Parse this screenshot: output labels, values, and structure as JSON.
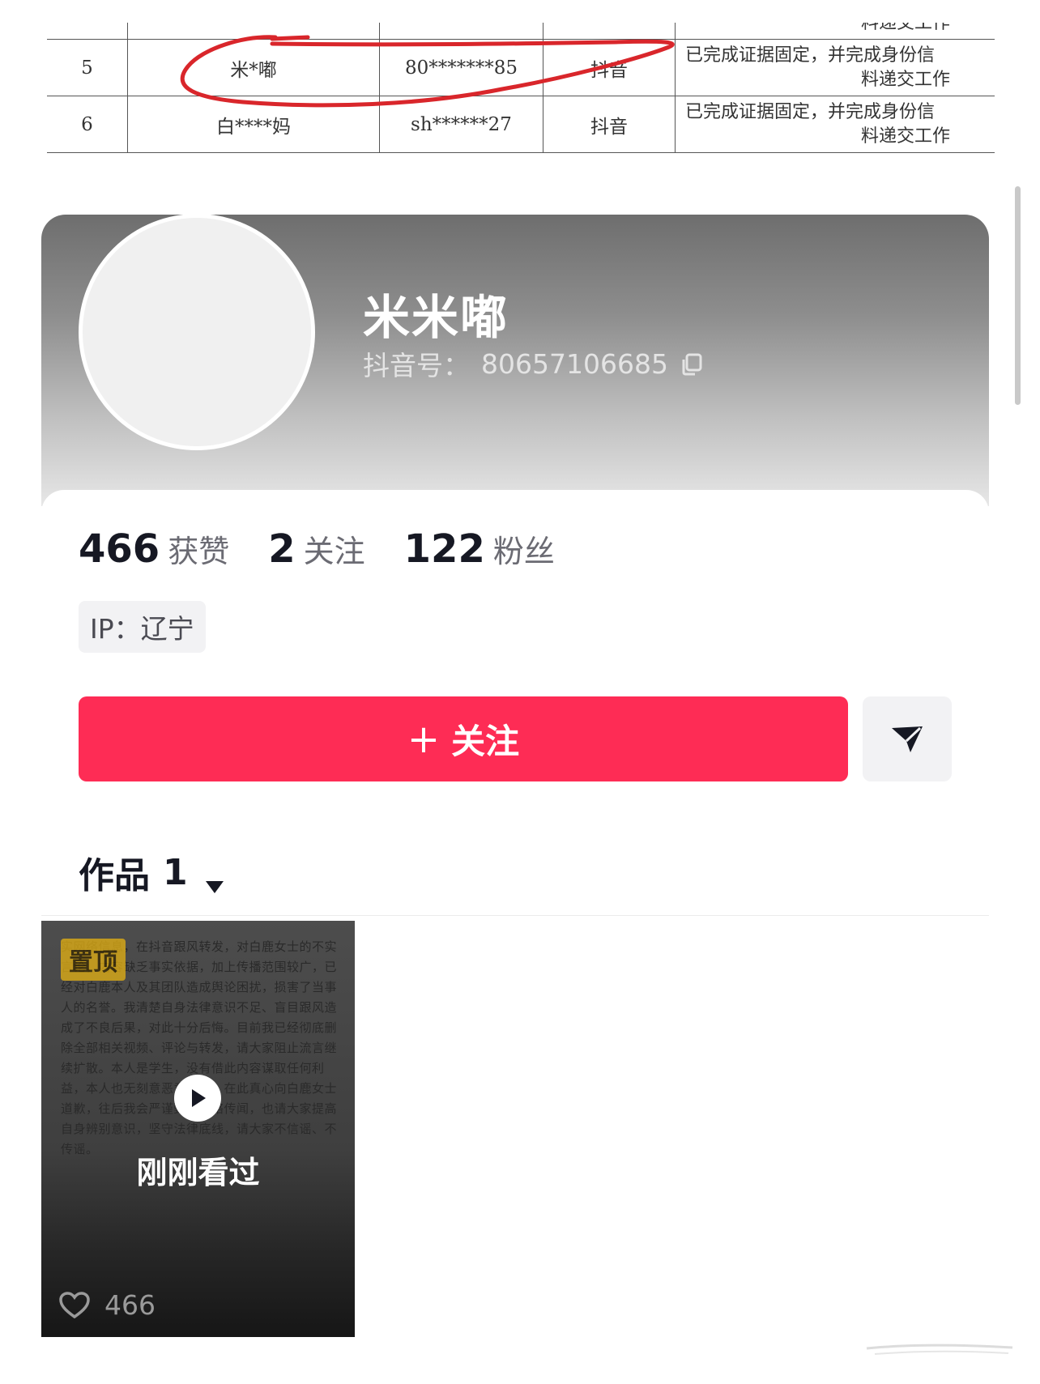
{
  "doc_table": {
    "top_row_fragment": "料递交工作",
    "rows": [
      {
        "no": "5",
        "name": "米*嘟",
        "account": "80*******85",
        "platform": "抖音",
        "status_line1": "已完成证据固定，并完成身份信",
        "status_line2": "料递交工作"
      },
      {
        "no": "6",
        "name": "白****妈",
        "account": "sh******27",
        "platform": "抖音",
        "status_line1": "已完成证据固定，并完成身份信",
        "status_line2": "料递交工作"
      }
    ],
    "highlight_color": "#d9262b"
  },
  "profile": {
    "nickname": "米米嘟",
    "douyin_id_label": "抖音号：",
    "douyin_id": "80657106685",
    "stats": [
      {
        "value": "466",
        "label": "获赞"
      },
      {
        "value": "2",
        "label": "关注"
      },
      {
        "value": "122",
        "label": "粉丝"
      }
    ],
    "ip": "IP：辽宁",
    "follow_plus": "+",
    "follow_label": "关注",
    "share_icon": "send-icon"
  },
  "works": {
    "tab_label": "作品",
    "count": "1",
    "caret_icon": "caret-down-icon"
  },
  "video": {
    "pin_label": "置顶",
    "background_text": "实网络信息，在抖音跟风转发，对白鹿女士的不实言论，内容缺乏事实依据，加上传播范围较广，已经对白鹿本人及其团队造成舆论困扰，损害了当事人的名誉。我清楚自身法律意识不足、盲目跟风造成了不良后果，对此十分后悔。目前我已经彻底删除全部相关视频、评论与转发，请大家阻止流言继续扩散。本人是学生，没有借此内容谋取任何利益，本人也无刻意恶意抹黑。在此真心向白鹿女士道歉，往后我会严谨甄别网络传闻，也请大家提高自身辨别意识，坚守法律底线，请大家不信谣、不传谣。",
    "watched_label": "刚刚看过",
    "likes": "466",
    "play_icon": "play-icon",
    "heart_icon": "heart-icon"
  },
  "colors": {
    "accent": "#fe2c55",
    "pin": "#e6b212"
  }
}
